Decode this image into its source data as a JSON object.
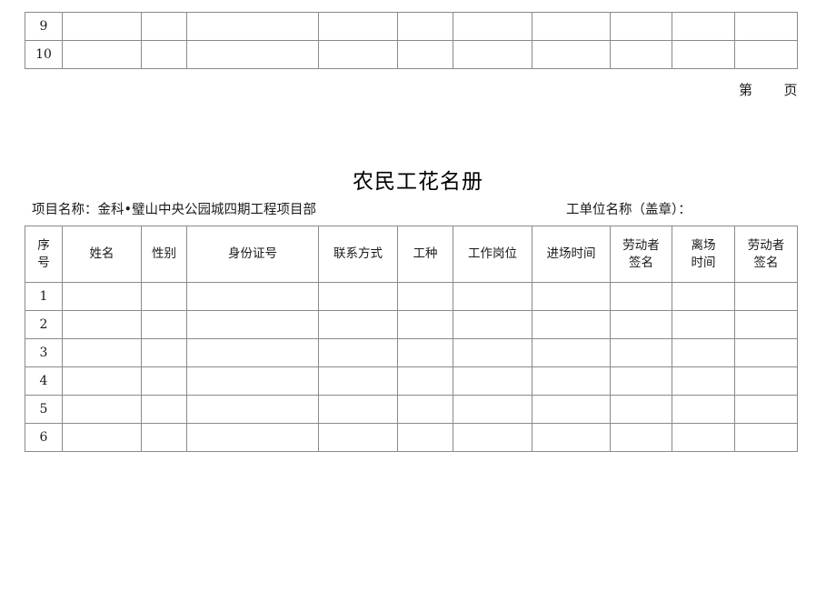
{
  "document": {
    "title": "农民工花名册",
    "page_label_prefix": "第",
    "page_label_suffix": "页"
  },
  "meta": {
    "project_label": "项目名称：金科•璧山中央公园城四期工程项目部",
    "unit_label": "工单位名称（盖章）："
  },
  "top_table": {
    "column_count": 11,
    "rows": [
      {
        "seq": "9",
        "cells": [
          "",
          "",
          "",
          "",
          "",
          "",
          "",
          "",
          "",
          ""
        ]
      },
      {
        "seq": "10",
        "cells": [
          "",
          "",
          "",
          "",
          "",
          "",
          "",
          "",
          "",
          ""
        ]
      }
    ]
  },
  "main_table": {
    "headers": [
      {
        "lines": [
          "序",
          "号"
        ]
      },
      {
        "lines": [
          "姓名"
        ]
      },
      {
        "lines": [
          "性别"
        ]
      },
      {
        "lines": [
          "身份证号"
        ]
      },
      {
        "lines": [
          "联系方式"
        ]
      },
      {
        "lines": [
          "工种"
        ]
      },
      {
        "lines": [
          "工作岗位"
        ]
      },
      {
        "lines": [
          "进场时间"
        ]
      },
      {
        "lines": [
          "劳动者",
          "签名"
        ]
      },
      {
        "lines": [
          "离场",
          "时间"
        ]
      },
      {
        "lines": [
          "劳动者",
          "签名"
        ]
      }
    ],
    "rows": [
      {
        "seq": "1",
        "cells": [
          "",
          "",
          "",
          "",
          "",
          "",
          "",
          "",
          "",
          ""
        ]
      },
      {
        "seq": "2",
        "cells": [
          "",
          "",
          "",
          "",
          "",
          "",
          "",
          "",
          "",
          ""
        ]
      },
      {
        "seq": "3",
        "cells": [
          "",
          "",
          "",
          "",
          "",
          "",
          "",
          "",
          "",
          ""
        ]
      },
      {
        "seq": "4",
        "cells": [
          "",
          "",
          "",
          "",
          "",
          "",
          "",
          "",
          "",
          ""
        ]
      },
      {
        "seq": "5",
        "cells": [
          "",
          "",
          "",
          "",
          "",
          "",
          "",
          "",
          "",
          ""
        ]
      },
      {
        "seq": "6",
        "cells": [
          "",
          "",
          "",
          "",
          "",
          "",
          "",
          "",
          "",
          ""
        ]
      }
    ]
  },
  "colors": {
    "page_background": "#ffffff",
    "border": "#8a8a8a",
    "text": "#1a1a1a"
  }
}
